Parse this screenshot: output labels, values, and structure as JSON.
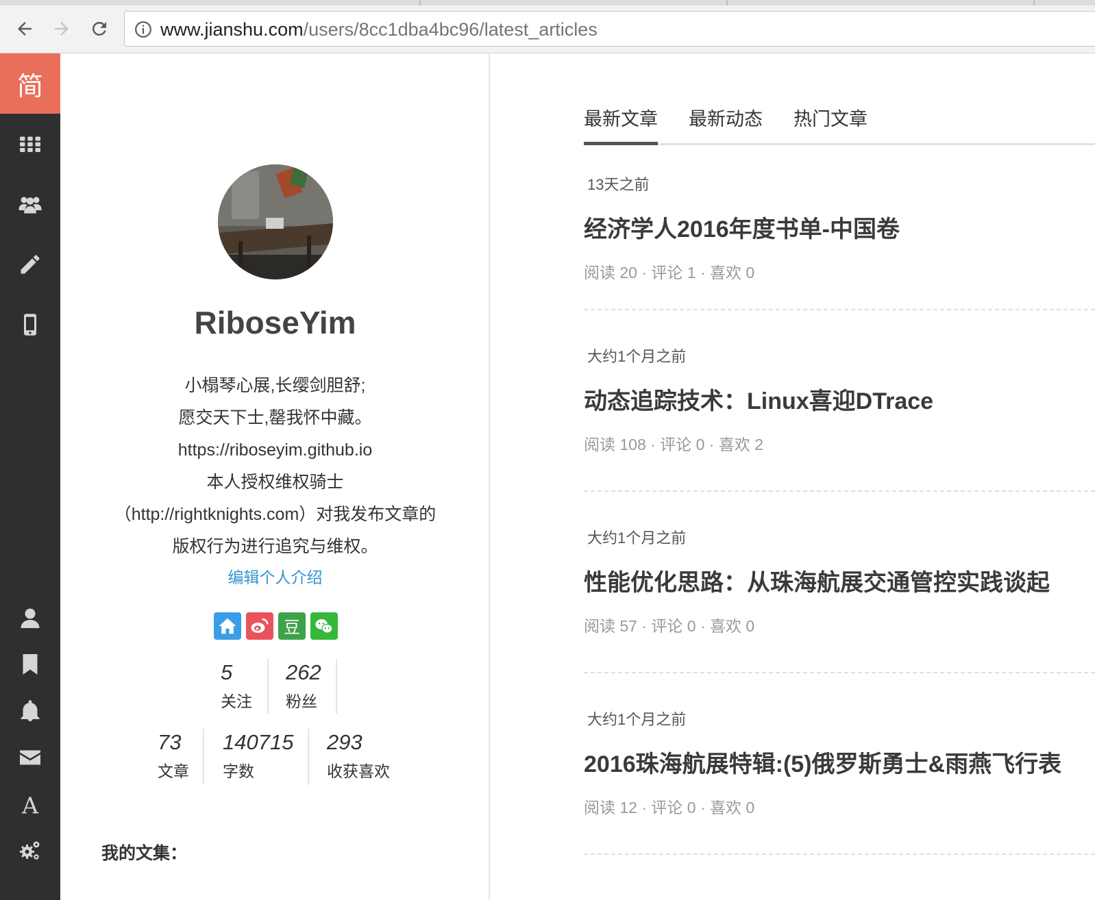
{
  "browser": {
    "url_host": "www.jianshu.com",
    "url_path": "/users/8cc1dba4bc96/latest_articles"
  },
  "sidebar": {
    "brand_label": "简",
    "top_icons": [
      "apps-grid-icon",
      "users-group-icon",
      "pencil-icon",
      "mobile-phone-icon"
    ],
    "bottom_icons": [
      "user-icon",
      "bookmark-icon",
      "bell-icon",
      "mail-icon",
      "font-icon",
      "settings-gears-icon"
    ],
    "brand_color": "#ea6f5a",
    "background_color": "#2f2f2f"
  },
  "profile": {
    "name": "RiboseYim",
    "bio_lines": [
      "小榻琴心展,长缨剑胆舒;",
      "愿交天下士,罄我怀中藏。",
      "https://riboseyim.github.io",
      "本人授权维权骑士",
      "（http://rightknights.com）对我发布文章的",
      "版权行为进行追究与维权。"
    ],
    "edit_intro": "编辑个人介绍",
    "socials": [
      "home-icon",
      "weibo-icon",
      "douban-icon",
      "wechat-icon"
    ],
    "stats_row1": [
      {
        "value": "5",
        "label": "关注"
      },
      {
        "value": "262",
        "label": "粉丝"
      }
    ],
    "stats_row2": [
      {
        "value": "73",
        "label": "文章"
      },
      {
        "value": "140715",
        "label": "字数"
      },
      {
        "value": "293",
        "label": "收获喜欢"
      }
    ],
    "my_collections": "我的文集："
  },
  "tabs": [
    {
      "label": "最新文章",
      "active": true
    },
    {
      "label": "最新动态",
      "active": false
    },
    {
      "label": "热门文章",
      "active": false
    }
  ],
  "articles": [
    {
      "time": "13天之前",
      "title": "经济学人2016年度书单-中国卷",
      "meta": "阅读 20 · 评论 1 · 喜欢 0"
    },
    {
      "time": "大约1个月之前",
      "title": "动态追踪技术：Linux喜迎DTrace",
      "meta": "阅读 108 · 评论 0 · 喜欢 2"
    },
    {
      "time": "大约1个月之前",
      "title": "性能优化思路：从珠海航展交通管控实践谈起",
      "meta": "阅读 57 · 评论 0 · 喜欢 0"
    },
    {
      "time": "大约1个月之前",
      "title": "2016珠海航展特辑:(5)俄罗斯勇士&雨燕飞行表",
      "meta": "阅读 12 · 评论 0 · 喜欢 0"
    }
  ],
  "accent_link_color": "#3194d0"
}
